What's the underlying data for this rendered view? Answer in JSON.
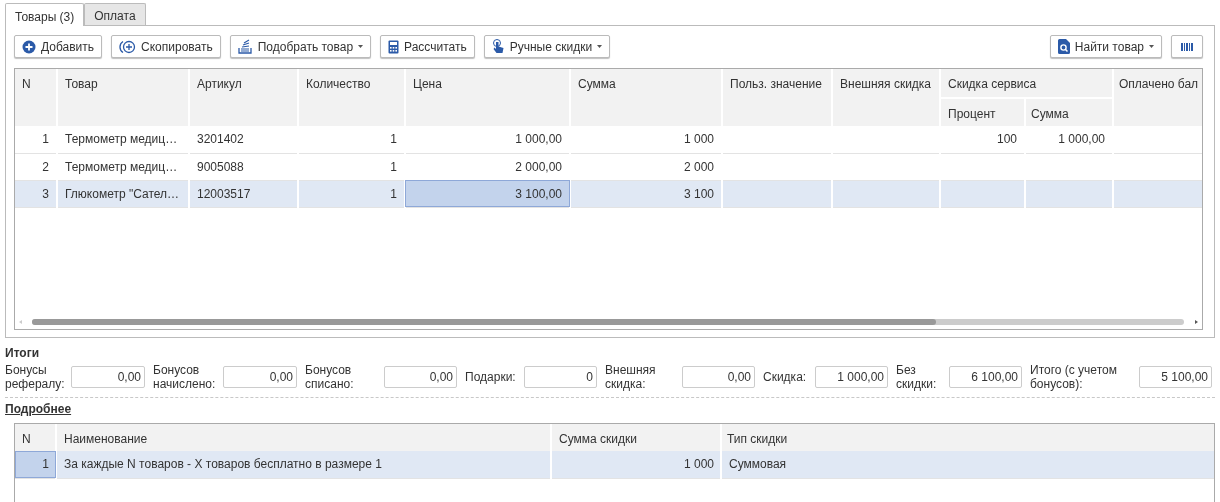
{
  "tabs": [
    {
      "label": "Товары (3)",
      "selected": true
    },
    {
      "label": "Оплата",
      "selected": false
    }
  ],
  "toolbar": {
    "left": [
      {
        "label": "Добавить",
        "dropdown": false
      },
      {
        "label": "Скопировать",
        "dropdown": false
      },
      {
        "label": "Подобрать товар",
        "dropdown": true
      },
      {
        "label": "Рассчитать",
        "dropdown": false
      },
      {
        "label": "Ручные скидки",
        "dropdown": true
      }
    ],
    "right": [
      {
        "label": "Найти товар",
        "dropdown": true
      }
    ]
  },
  "goods_table": {
    "columns": [
      {
        "label": "N",
        "kind": "number"
      },
      {
        "label": "Товар",
        "kind": "text"
      },
      {
        "label": "Артикул",
        "kind": "text"
      },
      {
        "label": "Количество",
        "kind": "number"
      },
      {
        "label": "Цена",
        "kind": "number"
      },
      {
        "label": "Сумма",
        "kind": "number"
      },
      {
        "label": "Польз. значение",
        "kind": "text"
      },
      {
        "label": "Внешняя скидка",
        "kind": "number"
      },
      {
        "label": "Процент",
        "kind": "number",
        "grouped": true
      },
      {
        "label": "Сумма",
        "kind": "number",
        "grouped": true
      },
      {
        "label": "Оплачено бал",
        "kind": "number"
      }
    ],
    "column_group": {
      "label": "Скидка сервиса"
    },
    "rows": [
      {
        "selected": false,
        "cells": [
          {
            "text": "1",
            "focused": false
          },
          {
            "text": "Термометр медиц…",
            "focused": false
          },
          {
            "text": "3201402",
            "focused": false
          },
          {
            "text": "1",
            "focused": false
          },
          {
            "text": "1 000,00",
            "focused": false
          },
          {
            "text": "1 000",
            "focused": false
          },
          {
            "focused": false
          },
          {
            "focused": false
          },
          {
            "text": "100",
            "focused": false
          },
          {
            "text": "1 000,00",
            "focused": false
          },
          {
            "focused": false
          }
        ]
      },
      {
        "selected": false,
        "cells": [
          {
            "text": "2",
            "focused": false
          },
          {
            "text": "Термометр медиц…",
            "focused": false
          },
          {
            "text": "9005088",
            "focused": false
          },
          {
            "text": "1",
            "focused": false
          },
          {
            "text": "2 000,00",
            "focused": false
          },
          {
            "text": "2 000",
            "focused": false
          },
          {
            "focused": false
          },
          {
            "focused": false
          },
          {
            "focused": false
          },
          {
            "focused": false
          },
          {
            "focused": false
          }
        ]
      },
      {
        "selected": true,
        "cells": [
          {
            "text": "3",
            "focused": false
          },
          {
            "text": "Глюкометр \"Сател…",
            "focused": false
          },
          {
            "text": "12003517",
            "focused": false
          },
          {
            "text": "1",
            "focused": false
          },
          {
            "text": "3 100,00",
            "focused": true
          },
          {
            "text": "3 100",
            "focused": false
          },
          {
            "focused": false
          },
          {
            "focused": false
          },
          {
            "focused": false
          },
          {
            "focused": false
          },
          {
            "focused": false
          }
        ]
      }
    ]
  },
  "totals": {
    "title": "Итоги",
    "fields": [
      {
        "label": "Бонусы рефералу:",
        "value": "0,00"
      },
      {
        "label": "Бонусов начислено:",
        "value": "0,00"
      },
      {
        "label": "Бонусов списано:",
        "value": "0,00"
      },
      {
        "label": "Подарки:",
        "value": "0"
      },
      {
        "label": "Внешняя скидка:",
        "value": "0,00"
      },
      {
        "label": "Скидка:",
        "value": "1 000,00"
      },
      {
        "label": "Без скидки:",
        "value": "6 100,00"
      },
      {
        "label": "Итого (с учетом бонусов):",
        "value": "5 100,00"
      }
    ]
  },
  "details": {
    "title": "Подробнее",
    "columns": [
      {
        "label": "N",
        "kind": "number"
      },
      {
        "label": "Наименование",
        "kind": "text"
      },
      {
        "label": "Сумма скидки",
        "kind": "number"
      },
      {
        "label": "Тип скидки",
        "kind": "text"
      }
    ],
    "rows": [
      {
        "selected": true,
        "cells": [
          {
            "text": "1",
            "focused": true
          },
          {
            "text": "За каждые N товаров - X товаров бесплатно в размере 1",
            "focused": false
          },
          {
            "text": "1 000",
            "focused": false
          },
          {
            "text": "Суммовая",
            "focused": false
          }
        ]
      }
    ]
  }
}
